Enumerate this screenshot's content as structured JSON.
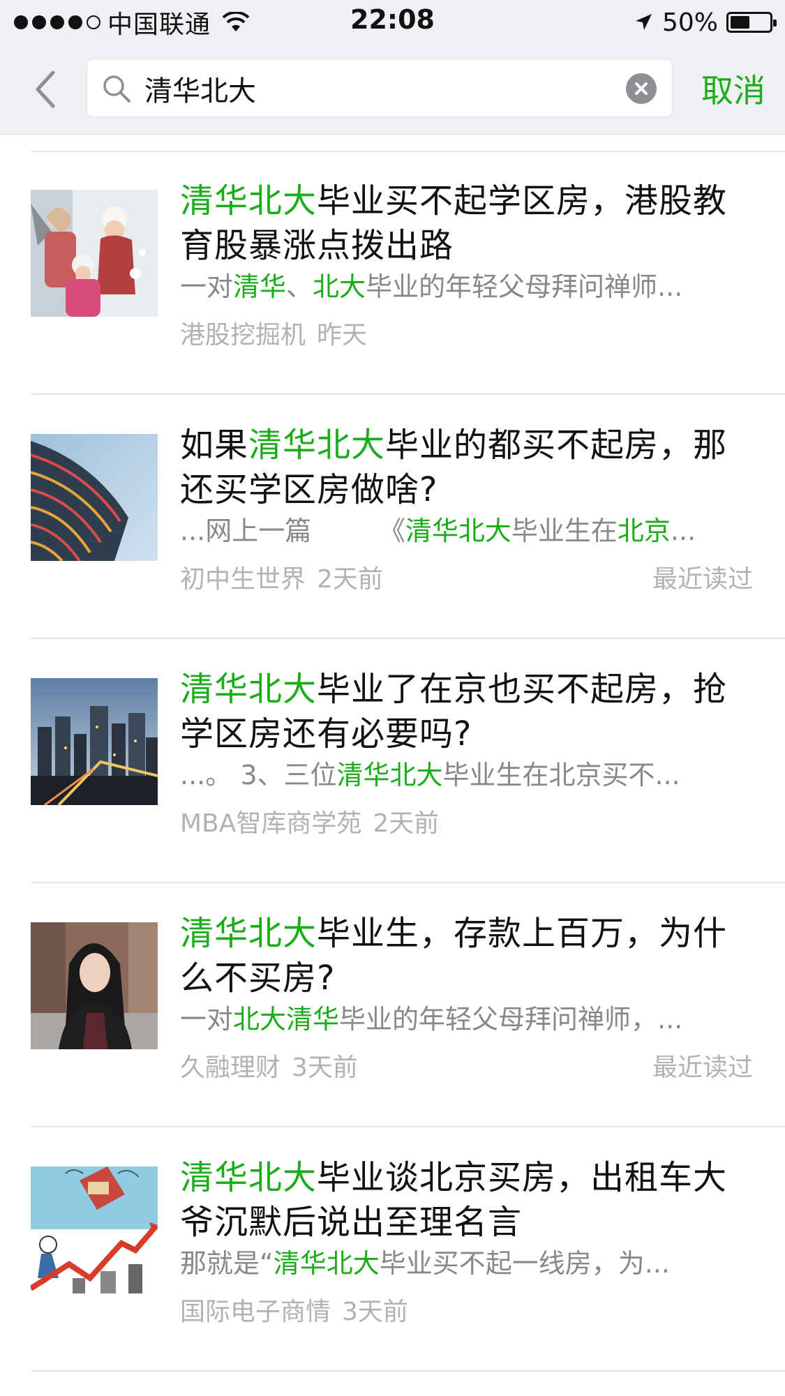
{
  "status_bar": {
    "carrier": "中国联通",
    "time": "22:08",
    "battery_percent": "50%",
    "battery_level": 0.5,
    "signal_icon": "signal-dots-icon",
    "wifi_icon": "wifi-icon",
    "location_icon": "location-arrow-icon"
  },
  "search": {
    "query": "清华北大",
    "cancel_label": "取消"
  },
  "colors": {
    "highlight": "#1aad19",
    "meta": "#b2b2b2",
    "digest": "#888888"
  },
  "results": [
    {
      "title_parts": [
        {
          "text": "清华北大",
          "hl": true
        },
        {
          "text": "毕业买不起学区房，港股教育股暴涨点拨出路",
          "hl": false
        }
      ],
      "digest_parts": [
        {
          "text": "一对",
          "hl": false
        },
        {
          "text": "清华",
          "hl": true
        },
        {
          "text": "、",
          "hl": false
        },
        {
          "text": "北大",
          "hl": true
        },
        {
          "text": "毕业的年轻父母拜问禅师...",
          "hl": false
        }
      ],
      "source": "港股挖掘机",
      "time": "昨天",
      "read_tag": "",
      "thumb": "family-snow"
    },
    {
      "title_parts": [
        {
          "text": "如果",
          "hl": false
        },
        {
          "text": "清华北大",
          "hl": true
        },
        {
          "text": "毕业的都买不起房，那还买学区房做啥?",
          "hl": false
        }
      ],
      "digest_parts": [
        {
          "text": "...网上一篇        《",
          "hl": false
        },
        {
          "text": "清华北大",
          "hl": true
        },
        {
          "text": "毕业生在",
          "hl": false
        },
        {
          "text": "北京",
          "hl": true
        },
        {
          "text": "...",
          "hl": false
        }
      ],
      "source": "初中生世界",
      "time": "2天前",
      "read_tag": "最近读过",
      "thumb": "building"
    },
    {
      "title_parts": [
        {
          "text": "清华北大",
          "hl": true
        },
        {
          "text": "毕业了在京也买不起房，抢学区房还有必要吗?",
          "hl": false
        }
      ],
      "digest_parts": [
        {
          "text": "...。 3、三位",
          "hl": false
        },
        {
          "text": "清华北大",
          "hl": true
        },
        {
          "text": "毕业生在北京买不...",
          "hl": false
        }
      ],
      "source": "MBA智库商学苑",
      "time": "2天前",
      "read_tag": "",
      "thumb": "city-night"
    },
    {
      "title_parts": [
        {
          "text": "清华北大",
          "hl": true
        },
        {
          "text": "毕业生，存款上百万，为什么不买房?",
          "hl": false
        }
      ],
      "digest_parts": [
        {
          "text": "一对",
          "hl": false
        },
        {
          "text": "北大清华",
          "hl": true
        },
        {
          "text": "毕业的年轻父母拜问禅师，...",
          "hl": false
        }
      ],
      "source": "久融理财",
      "time": "3天前",
      "read_tag": "最近读过",
      "thumb": "woman"
    },
    {
      "title_parts": [
        {
          "text": "清华北大",
          "hl": true
        },
        {
          "text": "毕业谈北京买房，出租车大爷沉默后说出至理名言",
          "hl": false
        }
      ],
      "digest_parts": [
        {
          "text": "那就是“",
          "hl": false
        },
        {
          "text": "清华北大",
          "hl": true
        },
        {
          "text": "毕业买不起一线房，为...",
          "hl": false
        }
      ],
      "source": "国际电子商情",
      "time": "3天前",
      "read_tag": "",
      "thumb": "house-cartoon"
    }
  ]
}
